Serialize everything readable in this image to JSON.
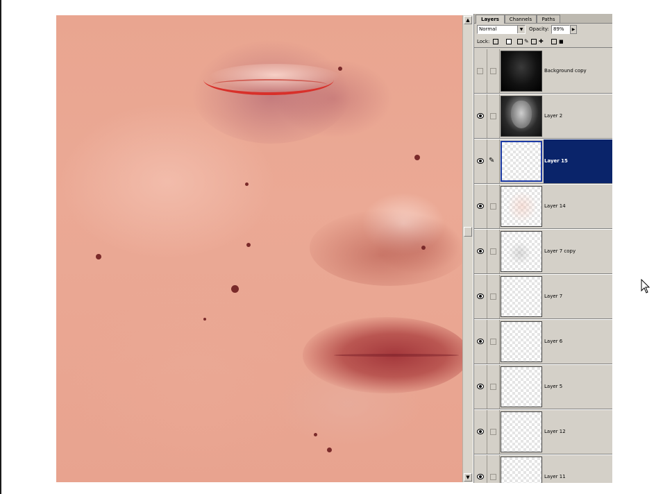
{
  "palette": {
    "tabs": [
      {
        "label": "Layers",
        "active": true
      },
      {
        "label": "Channels",
        "active": false
      },
      {
        "label": "Paths",
        "active": false
      }
    ],
    "blend_mode": "Normal",
    "opacity_label": "Opacity:",
    "opacity_value": "89%",
    "lock_label": "Lock:",
    "layers": [
      {
        "name": "Background copy",
        "visible": false,
        "thumbnail": "dark",
        "selected": false,
        "brush": false
      },
      {
        "name": "Layer 2",
        "visible": true,
        "thumbnail": "face",
        "selected": false,
        "brush": false
      },
      {
        "name": "Layer 15",
        "visible": true,
        "thumbnail": "transparent",
        "selected": true,
        "brush": true
      },
      {
        "name": "Layer 14",
        "visible": true,
        "thumbnail": "pinkish",
        "selected": false,
        "brush": false
      },
      {
        "name": "Layer 7 copy",
        "visible": true,
        "thumbnail": "greyish",
        "selected": false,
        "brush": false
      },
      {
        "name": "Layer 7",
        "visible": true,
        "thumbnail": "transparent",
        "selected": false,
        "brush": false
      },
      {
        "name": "Layer 6",
        "visible": true,
        "thumbnail": "transparent",
        "selected": false,
        "brush": false
      },
      {
        "name": "Layer 5",
        "visible": true,
        "thumbnail": "transparent",
        "selected": false,
        "brush": false
      },
      {
        "name": "Layer 12",
        "visible": true,
        "thumbnail": "transparent",
        "selected": false,
        "brush": false
      },
      {
        "name": "Layer 11",
        "visible": true,
        "thumbnail": "transparent",
        "selected": false,
        "brush": false
      }
    ]
  },
  "colors": {
    "selection": "#0a246a",
    "panel": "#d4d0c8",
    "skin": "#e9a590"
  },
  "icons": {
    "visibility": "eye-icon",
    "paint": "brush-icon",
    "lock": "lock-icon",
    "cursor": "mouse-pointer-icon"
  }
}
